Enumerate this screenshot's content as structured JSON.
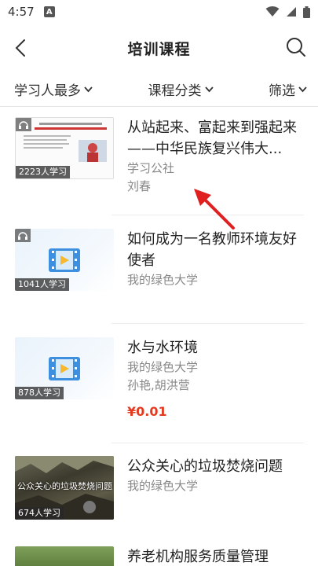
{
  "status_bar": {
    "time": "4:57",
    "notification_badge": "A"
  },
  "header": {
    "title": "培训课程"
  },
  "filters": [
    {
      "label": "学习人最多"
    },
    {
      "label": "课程分类"
    },
    {
      "label": "筛选"
    }
  ],
  "courses": [
    {
      "title": "从站起来、富起来到强起来——中华民族复兴伟大...",
      "publisher": "学习公社",
      "author": "刘春",
      "learners": "2223人学习",
      "thumb_caption": "从站起来、富起来到强起来——中华民族复兴伟大征程",
      "has_audio": true
    },
    {
      "title": "如何成为一名教师环境友好使者",
      "publisher": "我的绿色大学",
      "learners": "1041人学习",
      "has_audio": true
    },
    {
      "title": "水与水环境",
      "publisher": "我的绿色大学",
      "author": "孙艳,胡洪营",
      "price": "¥0.01",
      "learners": "878人学习"
    },
    {
      "title": "公众关心的垃圾焚烧问题",
      "publisher": "我的绿色大学",
      "learners": "674人学习",
      "thumb_caption": "公众关心的垃圾焚烧问题"
    },
    {
      "title": "养老机构服务质量管理"
    }
  ],
  "colors": {
    "price": "#e23b20",
    "accent_blue": "#3d8fe0",
    "video_icon_yellow": "#f5b82e",
    "annotation_arrow": "#e02020"
  }
}
